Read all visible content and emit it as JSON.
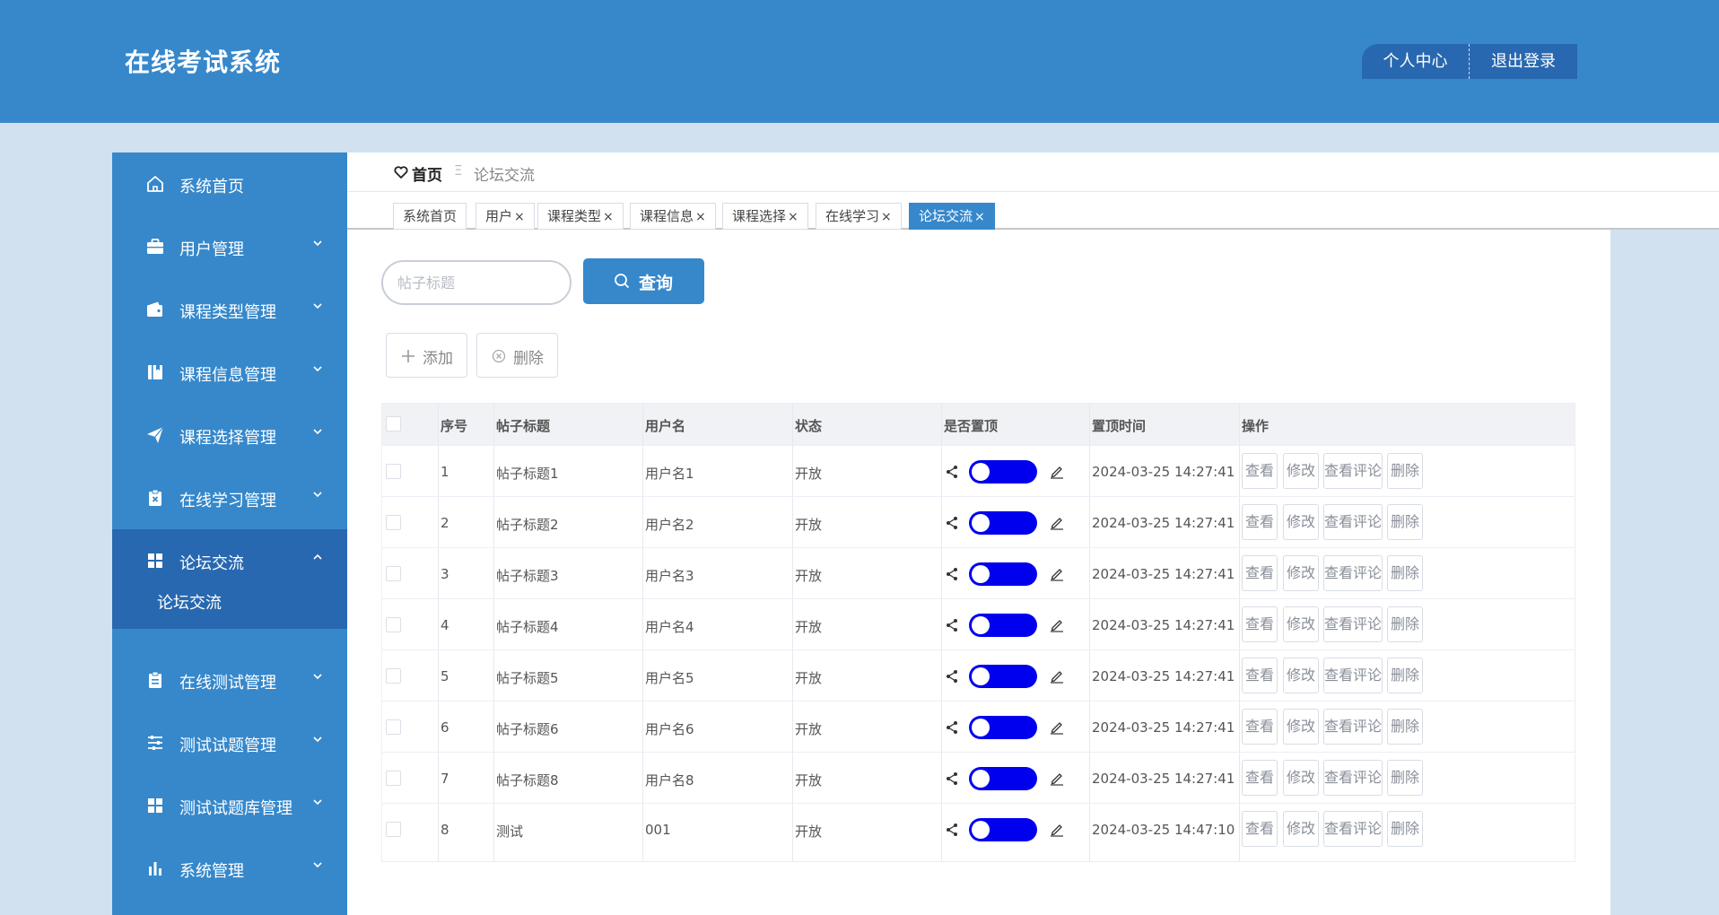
{
  "app": {
    "title": "在线考试系统"
  },
  "header": {
    "user_center": "个人中心",
    "logout": "退出登录"
  },
  "sidebar": {
    "items": [
      {
        "label": "系统首页",
        "icon": "home-icon",
        "has_children": false
      },
      {
        "label": "用户管理",
        "icon": "briefcase-icon",
        "has_children": true
      },
      {
        "label": "课程类型管理",
        "icon": "wallet-icon",
        "has_children": true
      },
      {
        "label": "课程信息管理",
        "icon": "book-icon",
        "has_children": true
      },
      {
        "label": "课程选择管理",
        "icon": "paper-plane-icon",
        "has_children": true
      },
      {
        "label": "在线学习管理",
        "icon": "clipboard-x-icon",
        "has_children": true
      },
      {
        "label": "论坛交流",
        "icon": "grid-icon",
        "has_children": true,
        "expanded": true,
        "children": [
          "论坛交流"
        ]
      },
      {
        "label": "在线测试管理",
        "icon": "clipboard-icon",
        "has_children": true
      },
      {
        "label": "测试试题管理",
        "icon": "sliders-icon",
        "has_children": true
      },
      {
        "label": "测试试题库管理",
        "icon": "grid-icon",
        "has_children": true
      },
      {
        "label": "系统管理",
        "icon": "bar-chart-icon",
        "has_children": true
      }
    ]
  },
  "breadcrumb": {
    "home": "首页",
    "separator": "Ξ",
    "current": "论坛交流"
  },
  "tabs": [
    {
      "label": "系统首页",
      "closable": false
    },
    {
      "label": "用户",
      "closable": true
    },
    {
      "label": "课程类型",
      "closable": true
    },
    {
      "label": "课程信息",
      "closable": true
    },
    {
      "label": "课程选择",
      "closable": true
    },
    {
      "label": "在线学习",
      "closable": true
    },
    {
      "label": "论坛交流",
      "closable": true,
      "active": true
    }
  ],
  "tab_close_symbol": "×",
  "search": {
    "placeholder": "帖子标题",
    "value": "",
    "button_label": "查询"
  },
  "actions": {
    "add_label": "添加",
    "delete_label": "删除"
  },
  "table": {
    "columns": [
      "序号",
      "帖子标题",
      "用户名",
      "状态",
      "是否置顶",
      "置顶时间",
      "操作"
    ],
    "row_action_labels": [
      "查看",
      "修改",
      "查看评论",
      "删除"
    ],
    "rows": [
      {
        "index": "1",
        "title": "帖子标题1",
        "user": "用户名1",
        "status": "开放",
        "pinned": true,
        "pinned_time": "2024-03-25 14:27:41"
      },
      {
        "index": "2",
        "title": "帖子标题2",
        "user": "用户名2",
        "status": "开放",
        "pinned": true,
        "pinned_time": "2024-03-25 14:27:41"
      },
      {
        "index": "3",
        "title": "帖子标题3",
        "user": "用户名3",
        "status": "开放",
        "pinned": true,
        "pinned_time": "2024-03-25 14:27:41"
      },
      {
        "index": "4",
        "title": "帖子标题4",
        "user": "用户名4",
        "status": "开放",
        "pinned": true,
        "pinned_time": "2024-03-25 14:27:41"
      },
      {
        "index": "5",
        "title": "帖子标题5",
        "user": "用户名5",
        "status": "开放",
        "pinned": true,
        "pinned_time": "2024-03-25 14:27:41"
      },
      {
        "index": "6",
        "title": "帖子标题6",
        "user": "用户名6",
        "status": "开放",
        "pinned": true,
        "pinned_time": "2024-03-25 14:27:41"
      },
      {
        "index": "7",
        "title": "帖子标题8",
        "user": "用户名8",
        "status": "开放",
        "pinned": true,
        "pinned_time": "2024-03-25 14:27:41"
      },
      {
        "index": "8",
        "title": "测试",
        "user": "001",
        "status": "开放",
        "pinned": true,
        "pinned_time": "2024-03-25 14:47:10"
      }
    ]
  },
  "colors": {
    "primary": "#3688cb",
    "primary_dark": "#2868b0",
    "toggle_on": "#0000ee",
    "page_bg": "#d1e1f0"
  }
}
